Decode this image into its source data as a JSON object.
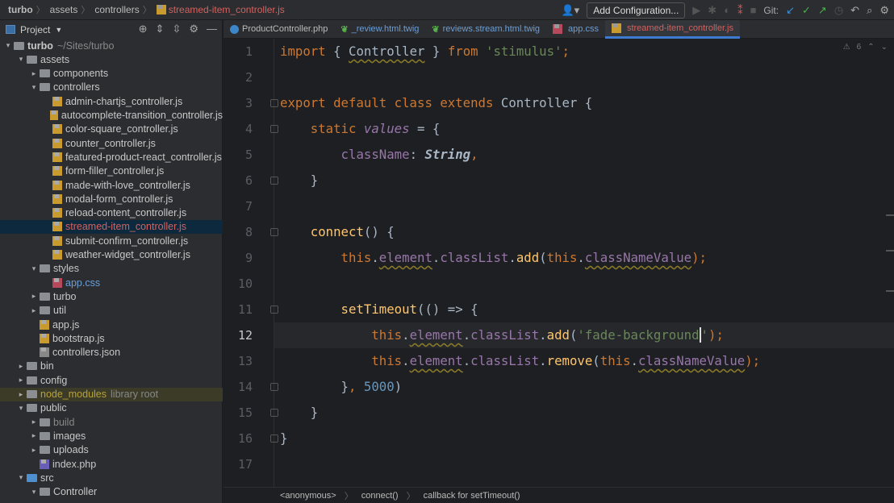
{
  "breadcrumb": [
    "turbo",
    "assets",
    "controllers",
    "streamed-item_controller.js"
  ],
  "toolbar": {
    "add_config": "Add Configuration...",
    "git_label": "Git:"
  },
  "project": {
    "title": "Project"
  },
  "tree": [
    {
      "level": 0,
      "type": "folder",
      "name": "turbo",
      "extra": "~/Sites/turbo",
      "open": true,
      "bold": true
    },
    {
      "level": 1,
      "type": "folder",
      "name": "assets",
      "open": true
    },
    {
      "level": 2,
      "type": "folder",
      "name": "components",
      "open": false
    },
    {
      "level": 2,
      "type": "folder",
      "name": "controllers",
      "open": true
    },
    {
      "level": 3,
      "type": "js",
      "name": "admin-chartjs_controller.js"
    },
    {
      "level": 3,
      "type": "js",
      "name": "autocomplete-transition_controller.js"
    },
    {
      "level": 3,
      "type": "js",
      "name": "color-square_controller.js"
    },
    {
      "level": 3,
      "type": "js",
      "name": "counter_controller.js"
    },
    {
      "level": 3,
      "type": "js",
      "name": "featured-product-react_controller.js"
    },
    {
      "level": 3,
      "type": "js",
      "name": "form-filler_controller.js"
    },
    {
      "level": 3,
      "type": "js",
      "name": "made-with-love_controller.js"
    },
    {
      "level": 3,
      "type": "js",
      "name": "modal-form_controller.js"
    },
    {
      "level": 3,
      "type": "js",
      "name": "reload-content_controller.js"
    },
    {
      "level": 3,
      "type": "js",
      "name": "streamed-item_controller.js",
      "selected": true,
      "color": "#d2625f"
    },
    {
      "level": 3,
      "type": "js",
      "name": "submit-confirm_controller.js"
    },
    {
      "level": 3,
      "type": "js",
      "name": "weather-widget_controller.js"
    },
    {
      "level": 2,
      "type": "folder",
      "name": "styles",
      "open": true
    },
    {
      "level": 3,
      "type": "css",
      "name": "app.css",
      "color": "#6d9fd6"
    },
    {
      "level": 2,
      "type": "folder",
      "name": "turbo",
      "open": false
    },
    {
      "level": 2,
      "type": "folder",
      "name": "util",
      "open": false
    },
    {
      "level": 2,
      "type": "js",
      "name": "app.js"
    },
    {
      "level": 2,
      "type": "js",
      "name": "bootstrap.js"
    },
    {
      "level": 2,
      "type": "json",
      "name": "controllers.json"
    },
    {
      "level": 1,
      "type": "folder",
      "name": "bin",
      "open": false
    },
    {
      "level": 1,
      "type": "folder",
      "name": "config",
      "open": false
    },
    {
      "level": 1,
      "type": "folder",
      "name": "node_modules",
      "extra": "library root",
      "open": false,
      "lib": true,
      "color": "#b5a23c"
    },
    {
      "level": 1,
      "type": "folder",
      "name": "public",
      "open": true
    },
    {
      "level": 2,
      "type": "folder",
      "name": "build",
      "open": false,
      "color": "#888"
    },
    {
      "level": 2,
      "type": "folder",
      "name": "images",
      "open": false
    },
    {
      "level": 2,
      "type": "folder",
      "name": "uploads",
      "open": false
    },
    {
      "level": 2,
      "type": "php",
      "name": "index.php"
    },
    {
      "level": 1,
      "type": "folder",
      "name": "src",
      "open": true,
      "blue": true
    },
    {
      "level": 2,
      "type": "folder",
      "name": "Controller",
      "open": true
    }
  ],
  "tabs": [
    {
      "label": "ProductController.php",
      "icon": "php-class",
      "color": "#bbbbbb"
    },
    {
      "label": "_review.html.twig",
      "icon": "twig",
      "color": "#6d9fd6"
    },
    {
      "label": "reviews.stream.html.twig",
      "icon": "twig",
      "color": "#6d9fd6"
    },
    {
      "label": "app.css",
      "icon": "css",
      "color": "#6d9fd6"
    },
    {
      "label": "streamed-item_controller.js",
      "icon": "js",
      "color": "#d2625f",
      "active": true
    }
  ],
  "editor": {
    "warning_count": "6",
    "current_line": 12,
    "lines": [
      [
        [
          "import ",
          "k"
        ],
        [
          "{ ",
          "p"
        ],
        [
          "Controller",
          "p w"
        ],
        [
          " } ",
          "p"
        ],
        [
          "from ",
          "k"
        ],
        [
          "'stimulus'",
          "s"
        ],
        [
          ";",
          "k"
        ]
      ],
      [],
      [
        [
          "export default class extends ",
          "k"
        ],
        [
          "Controller {",
          "p"
        ]
      ],
      [
        [
          "    static ",
          "k"
        ],
        [
          "values",
          "mi"
        ],
        [
          " = {",
          "p"
        ]
      ],
      [
        [
          "        className",
          "m"
        ],
        [
          ": ",
          "p"
        ],
        [
          "String",
          "t"
        ],
        [
          ",",
          "k"
        ]
      ],
      [
        [
          "    }",
          "p"
        ]
      ],
      [],
      [
        [
          "    connect",
          "fn"
        ],
        [
          "() {",
          "p"
        ]
      ],
      [
        [
          "        this",
          "th"
        ],
        [
          ".",
          "p"
        ],
        [
          "element",
          "m w"
        ],
        [
          ".",
          "p"
        ],
        [
          "classList",
          "m"
        ],
        [
          ".",
          "p"
        ],
        [
          "add",
          "fn"
        ],
        [
          "(",
          "p"
        ],
        [
          "this",
          "th"
        ],
        [
          ".",
          "p"
        ],
        [
          "classNameValue",
          "m w"
        ],
        [
          ");",
          "k"
        ]
      ],
      [],
      [
        [
          "        setTimeout",
          "fn"
        ],
        [
          "(() => {",
          "p"
        ]
      ],
      [
        [
          "            this",
          "th"
        ],
        [
          ".",
          "p"
        ],
        [
          "element",
          "m w"
        ],
        [
          ".",
          "p"
        ],
        [
          "classList",
          "m"
        ],
        [
          ".",
          "p"
        ],
        [
          "add",
          "fn"
        ],
        [
          "(",
          "p"
        ],
        [
          "'fade-background",
          "s"
        ],
        [
          "",
          "caret"
        ],
        [
          "'",
          "s"
        ],
        [
          ");",
          "k"
        ]
      ],
      [
        [
          "            this",
          "th"
        ],
        [
          ".",
          "p"
        ],
        [
          "element",
          "m w"
        ],
        [
          ".",
          "p"
        ],
        [
          "classList",
          "m"
        ],
        [
          ".",
          "p"
        ],
        [
          "remove",
          "fn"
        ],
        [
          "(",
          "p"
        ],
        [
          "this",
          "th"
        ],
        [
          ".",
          "p"
        ],
        [
          "classNameValue",
          "m w"
        ],
        [
          ");",
          "k"
        ]
      ],
      [
        [
          "        }",
          "p"
        ],
        [
          ", ",
          "k"
        ],
        [
          "5000",
          "n"
        ],
        [
          ")",
          "p"
        ]
      ],
      [
        [
          "    }",
          "p"
        ]
      ],
      [
        [
          "}",
          "p"
        ]
      ],
      []
    ],
    "folds": [
      3,
      4,
      6,
      8,
      11,
      14,
      15,
      16
    ]
  },
  "status": [
    "<anonymous>",
    "connect()",
    "callback for setTimeout()"
  ]
}
